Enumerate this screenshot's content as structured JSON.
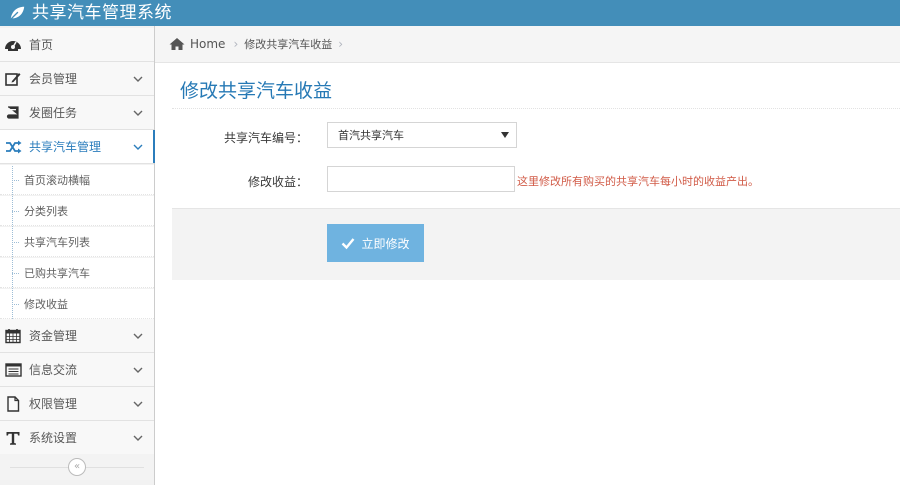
{
  "app": {
    "title": "共享汽车管理系统"
  },
  "colors": {
    "navbar": "#438eb9",
    "accent": "#2b7dbc",
    "button": "#6fb3e0",
    "help": "#d15b47"
  },
  "sidebar": {
    "items": [
      {
        "label": "首页",
        "icon": "dashboard-icon"
      },
      {
        "label": "会员管理",
        "icon": "edit-icon"
      },
      {
        "label": "发圈任务",
        "icon": "book-icon"
      },
      {
        "label": "共享汽车管理",
        "icon": "shuffle-icon"
      },
      {
        "label": "资金管理",
        "icon": "calendar-icon"
      },
      {
        "label": "信息交流",
        "icon": "list-icon"
      },
      {
        "label": "权限管理",
        "icon": "file-icon"
      },
      {
        "label": "系统设置",
        "icon": "text-icon"
      }
    ],
    "submenu": [
      {
        "label": "首页滚动横幅"
      },
      {
        "label": "分类列表"
      },
      {
        "label": "共享汽车列表"
      },
      {
        "label": "已购共享汽车"
      },
      {
        "label": "修改收益"
      }
    ],
    "collapse_label": "«"
  },
  "breadcrumb": {
    "home": "Home",
    "sep": "›",
    "current": "修改共享汽车收益"
  },
  "page": {
    "title": "修改共享汽车收益"
  },
  "form": {
    "car_label": "共享汽车编号：",
    "car_value": "首汽共享汽车",
    "income_label": "修改收益：",
    "income_value": "",
    "help": "这里修改所有购买的共享汽车每小时的收益产出。",
    "submit_label": "立即修改"
  }
}
